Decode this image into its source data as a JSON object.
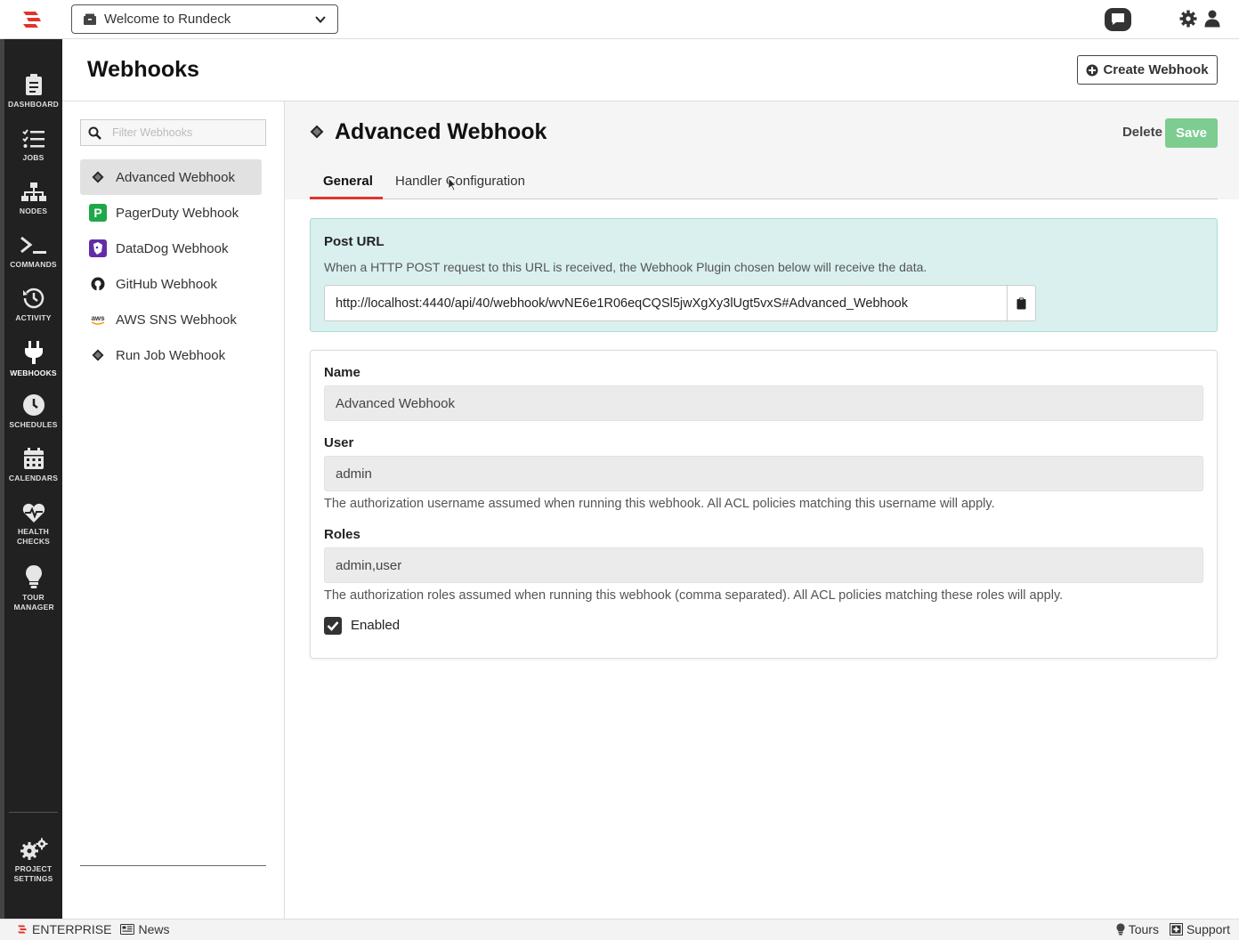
{
  "topbar": {
    "project": "Welcome to Rundeck"
  },
  "nav": {
    "items": [
      {
        "label": "DASHBOARD",
        "icon": "clipboard-icon"
      },
      {
        "label": "JOBS",
        "icon": "list-check-icon"
      },
      {
        "label": "NODES",
        "icon": "sitemap-icon"
      },
      {
        "label": "COMMANDS",
        "icon": "terminal-icon"
      },
      {
        "label": "ACTIVITY",
        "icon": "history-icon"
      },
      {
        "label": "WEBHOOKS",
        "icon": "plug-icon"
      },
      {
        "label": "SCHEDULES",
        "icon": "clock-icon"
      },
      {
        "label": "CALENDARS",
        "icon": "calendar-icon"
      },
      {
        "label": "HEALTH CHECKS",
        "icon": "heartbeat-icon"
      },
      {
        "label": "TOUR MANAGER",
        "icon": "lightbulb-icon"
      },
      {
        "label": "PROJECT SETTINGS",
        "icon": "gears-icon"
      }
    ]
  },
  "page": {
    "title": "Webhooks",
    "create_label": "Create Webhook"
  },
  "list": {
    "filter_placeholder": "Filter Webhooks",
    "items": [
      {
        "label": "Advanced Webhook",
        "icon": "diamond-icon"
      },
      {
        "label": "PagerDuty Webhook",
        "icon": "pagerduty-icon"
      },
      {
        "label": "DataDog Webhook",
        "icon": "datadog-icon"
      },
      {
        "label": "GitHub Webhook",
        "icon": "github-icon"
      },
      {
        "label": "AWS SNS Webhook",
        "icon": "aws-icon"
      },
      {
        "label": "Run Job Webhook",
        "icon": "diamond-icon"
      }
    ]
  },
  "detail": {
    "title": "Advanced Webhook",
    "delete_label": "Delete",
    "save_label": "Save",
    "tabs": [
      "General",
      "Handler Configuration"
    ],
    "post_url": {
      "heading": "Post URL",
      "description": "When a HTTP POST request to this URL is received, the Webhook Plugin chosen below will receive the data.",
      "url": "http://localhost:4440/api/40/webhook/wvNE6e1R06eqCQSl5jwXgXy3lUgt5vxS#Advanced_Webhook"
    },
    "form": {
      "name_label": "Name",
      "name_value": "Advanced Webhook",
      "user_label": "User",
      "user_value": "admin",
      "user_help": "The authorization username assumed when running this webhook. All ACL policies matching this username will apply.",
      "roles_label": "Roles",
      "roles_value": "admin,user",
      "roles_help": "The authorization roles assumed when running this webhook (comma separated). All ACL policies matching these roles will apply.",
      "enabled_label": "Enabled",
      "enabled": true
    }
  },
  "footer": {
    "edition": "ENTERPRISE",
    "news": "News",
    "tours": "Tours",
    "support": "Support"
  },
  "colors": {
    "accent": "#e0342c",
    "save": "#7ccd8f",
    "post_url_bg": "#d9f0ee",
    "nav_bg": "#212121"
  }
}
